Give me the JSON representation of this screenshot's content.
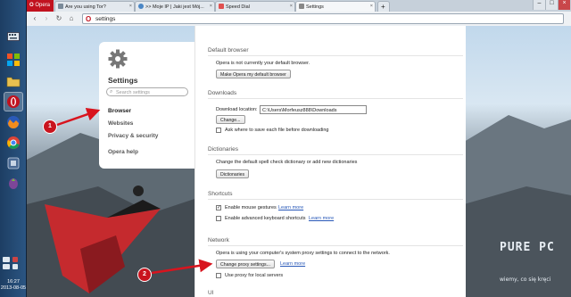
{
  "browser": {
    "app_tab": "Opera",
    "tabs": [
      {
        "label": "Are you using Tor?",
        "icon": "page-icon"
      },
      {
        "label": ">> Moje IP | Jaki jest Mój...",
        "icon": "globe-icon"
      },
      {
        "label": "Speed Dial",
        "icon": "speed-dial-icon"
      },
      {
        "label": "Settings",
        "icon": "settings-icon",
        "active": true
      }
    ],
    "url": "settings"
  },
  "taskbar": {
    "clock_time": "16:27",
    "clock_date": "2013-08-05"
  },
  "sidebar": {
    "title": "Settings",
    "search_placeholder": "Search settings",
    "items": [
      {
        "label": "Browser",
        "selected": true
      },
      {
        "label": "Websites"
      },
      {
        "label": "Privacy & security"
      },
      {
        "label": "Opera help"
      }
    ]
  },
  "content": {
    "default_browser": {
      "title": "Default browser",
      "status": "Opera is not currently your default browser.",
      "button": "Make Opera my default browser"
    },
    "downloads": {
      "title": "Downloads",
      "location_label": "Download location:",
      "location_value": "C:\\Users\\Morfeusz888\\Downloads",
      "change_button": "Change...",
      "ask_label": "Ask where to save each file before downloading",
      "ask_checked": false
    },
    "dictionaries": {
      "title": "Dictionaries",
      "description": "Change the default spell check dictionary or add new dictionaries",
      "button": "Dictionaries"
    },
    "shortcuts": {
      "title": "Shortcuts",
      "mouse_gestures_label": "Enable mouse gestures",
      "mouse_gestures_checked": true,
      "learn_more": "Learn more",
      "keyboard_label": "Enable advanced keyboard shortcuts",
      "keyboard_checked": false
    },
    "network": {
      "title": "Network",
      "description": "Opera is using your computer's system proxy settings to connect to the network.",
      "button": "Change proxy settings...",
      "learn_more": "Learn more",
      "local_proxy_label": "Use proxy for local servers",
      "local_proxy_checked": false
    },
    "ui": {
      "title": "UI"
    }
  },
  "annotations": {
    "badge_1": "1",
    "badge_2": "2",
    "color": "#c9141e"
  },
  "watermark": {
    "brand": "PURE PC",
    "tagline": "wiemy, co się kręci"
  },
  "colors": {
    "opera_red": "#c1121f",
    "link_blue": "#2858b8",
    "taskbar": "#1d3e63"
  }
}
